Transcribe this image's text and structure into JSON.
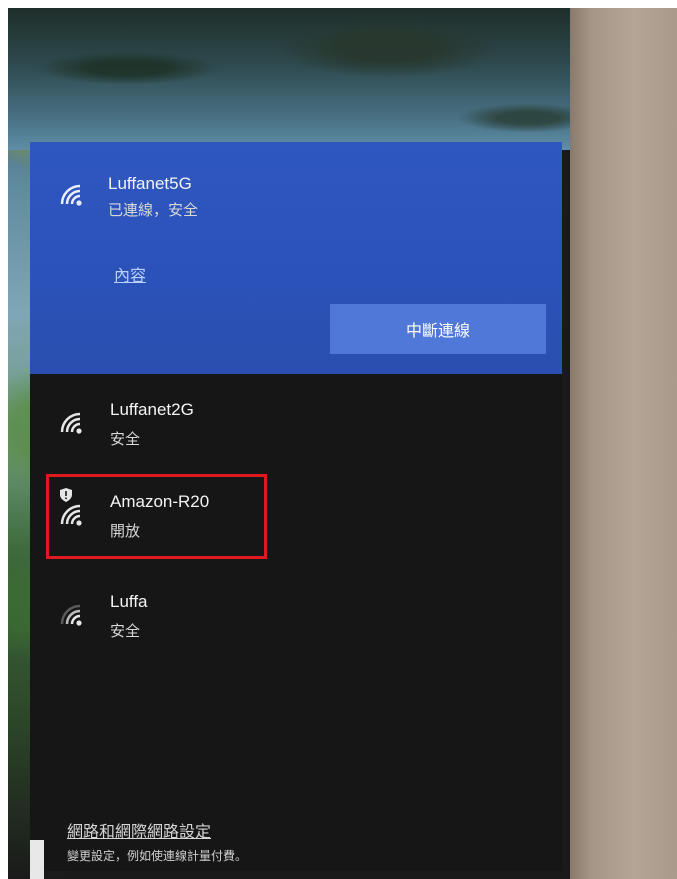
{
  "networks": {
    "connected": {
      "name": "Luffanet5G",
      "status": "已連線，安全",
      "properties_link": "內容",
      "disconnect_label": "中斷連線"
    },
    "items": [
      {
        "name": "Luffanet2G",
        "status": "安全"
      },
      {
        "name": "Amazon-R20",
        "status": "開放"
      },
      {
        "name": "Luffa",
        "status": "安全"
      }
    ]
  },
  "footer": {
    "settings_link": "網路和網際網路設定",
    "settings_desc": "變更設定，例如使連線計量付費。"
  },
  "colors": {
    "connected_bg": "#2b52b8",
    "button_bg": "#4f78d8",
    "highlight": "#e0191e"
  }
}
